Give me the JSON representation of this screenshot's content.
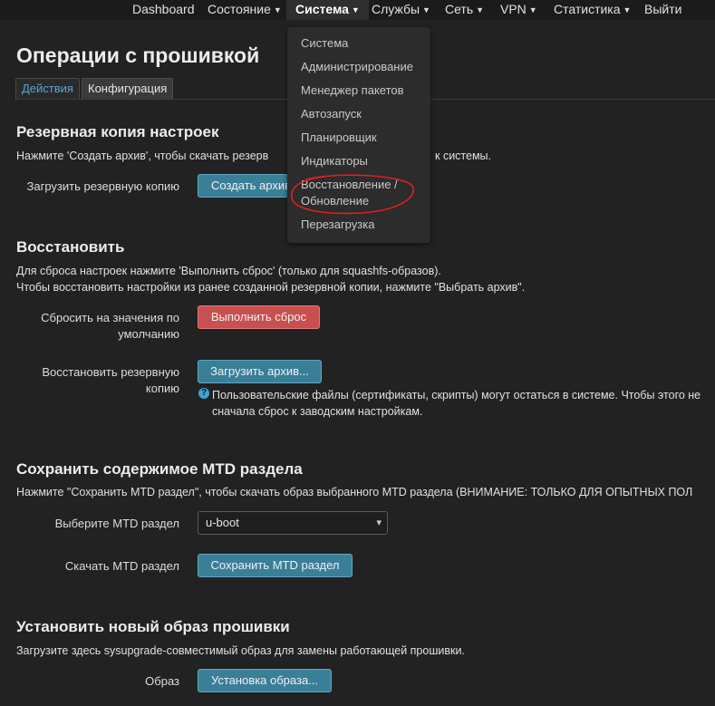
{
  "nav": {
    "items": [
      "Dashboard",
      "Состояние",
      "Система",
      "Службы",
      "Сеть",
      "VPN",
      "Статистика",
      "Выйти"
    ]
  },
  "dropdown": {
    "items": [
      "Система",
      "Администрирование",
      "Менеджер пакетов",
      "Автозапуск",
      "Планировщик",
      "Индикаторы",
      "Восстановление /",
      "Обновление",
      "Перезагрузка"
    ]
  },
  "page": {
    "title": "Операции с прошивкой",
    "tabs": [
      "Действия",
      "Конфигурация"
    ]
  },
  "backup": {
    "heading": "Резервная копия настроек",
    "desc": "Нажмите 'Создать архив', чтобы скачать резерв",
    "desc_tail": "к системы.",
    "label": "Загрузить резервную копию",
    "button": "Создать архив"
  },
  "restore": {
    "heading": "Восстановить",
    "desc1": "Для сброса настроек нажмите 'Выполнить сброс' (только для squashfs-образов).",
    "desc2": "Чтобы восстановить настройки из ранее созданной резервной копии, нажмите \"Выбрать архив\".",
    "reset_label_1": "Сбросить на значения по",
    "reset_label_2": "умолчанию",
    "reset_button": "Выполнить сброс",
    "restore_label_1": "Восстановить резервную",
    "restore_label_2": "копию",
    "restore_button": "Загрузить архив...",
    "help_1": "Пользовательские файлы (сертификаты, скрипты) могут остаться в системе. Чтобы этого не",
    "help_2": "сначала сброс к заводским настройкам."
  },
  "mtd": {
    "heading": "Сохранить содержимое MTD раздела",
    "desc": "Нажмите \"Сохранить MTD раздел\", чтобы скачать образ выбранного MTD раздела (ВНИМАНИЕ: ТОЛЬКО ДЛЯ ОПЫТНЫХ ПОЛ",
    "select_label": "Выберите MTD раздел",
    "select_value": "u-boot",
    "download_label": "Скачать MTD раздел",
    "save_button": "Сохранить MTD раздел"
  },
  "flash": {
    "heading": "Установить новый образ прошивки",
    "desc": "Загрузите здесь sysupgrade-совместимый образ для замены работающей прошивки.",
    "image_label": "Образ",
    "install_button": "Установка образа..."
  },
  "colors": {
    "background": "#222222",
    "accent": "#59a7d2",
    "button_blue": "#3a7f98",
    "button_red": "#c85050",
    "annotation_red": "#e02020"
  }
}
